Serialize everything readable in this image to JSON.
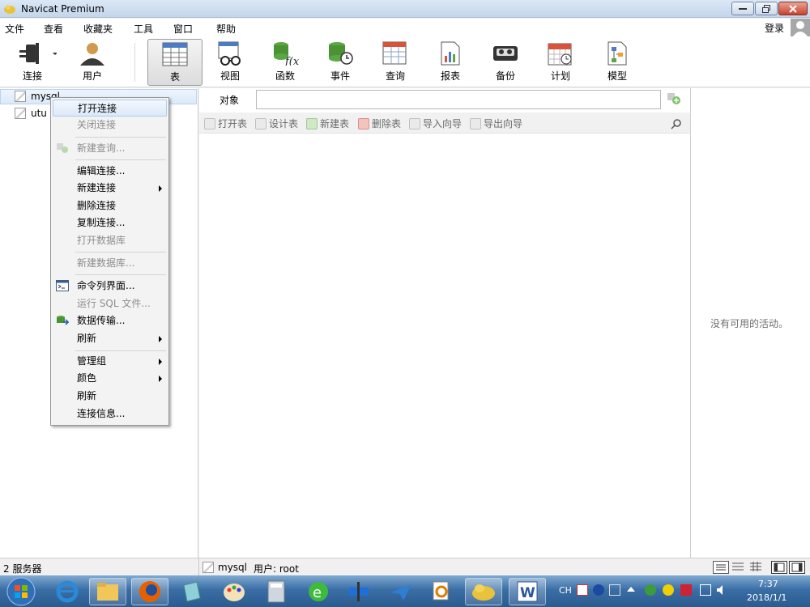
{
  "window": {
    "title": "Navicat Premium"
  },
  "menubar": {
    "items": [
      "文件",
      "查看",
      "收藏夹",
      "工具",
      "窗口",
      "帮助"
    ],
    "login": "登录"
  },
  "toolbar": {
    "items": [
      {
        "label": "连接",
        "icon": "plug-icon"
      },
      {
        "label": "用户",
        "icon": "user-icon"
      },
      {
        "label": "表",
        "icon": "table-icon"
      },
      {
        "label": "视图",
        "icon": "view-glasses-icon"
      },
      {
        "label": "函数",
        "icon": "function-icon"
      },
      {
        "label": "事件",
        "icon": "event-clock-icon"
      },
      {
        "label": "查询",
        "icon": "query-icon"
      },
      {
        "label": "报表",
        "icon": "report-icon"
      },
      {
        "label": "备份",
        "icon": "backup-tape-icon"
      },
      {
        "label": "计划",
        "icon": "schedule-calendar-icon"
      },
      {
        "label": "模型",
        "icon": "model-icon"
      }
    ]
  },
  "tree": {
    "items": [
      "mysql",
      "utu"
    ]
  },
  "object_panel": {
    "tab": "对象",
    "actions": [
      "打开表",
      "设计表",
      "新建表",
      "删除表",
      "导入向导",
      "导出向导"
    ]
  },
  "activity": {
    "empty_text": "没有可用的活动。"
  },
  "context_menu": {
    "items": [
      {
        "label": "打开连接"
      },
      {
        "label": "关闭连接"
      },
      {
        "label": "新建查询..."
      },
      {
        "label": "编辑连接..."
      },
      {
        "label": "新建连接"
      },
      {
        "label": "删除连接"
      },
      {
        "label": "复制连接..."
      },
      {
        "label": "打开数据库"
      },
      {
        "label": "新建数据库..."
      },
      {
        "label": "命令列界面..."
      },
      {
        "label": "运行 SQL 文件..."
      },
      {
        "label": "数据传输..."
      },
      {
        "label": "刷新"
      },
      {
        "label": "管理组"
      },
      {
        "label": "颜色"
      },
      {
        "label": "刷新"
      },
      {
        "label": "连接信息..."
      }
    ]
  },
  "statusbar": {
    "servers": "2 服务器",
    "connection": "mysql",
    "user": "用户: root"
  },
  "tray": {
    "lang": "CH",
    "time": "7:37",
    "date": "2018/1/1"
  }
}
